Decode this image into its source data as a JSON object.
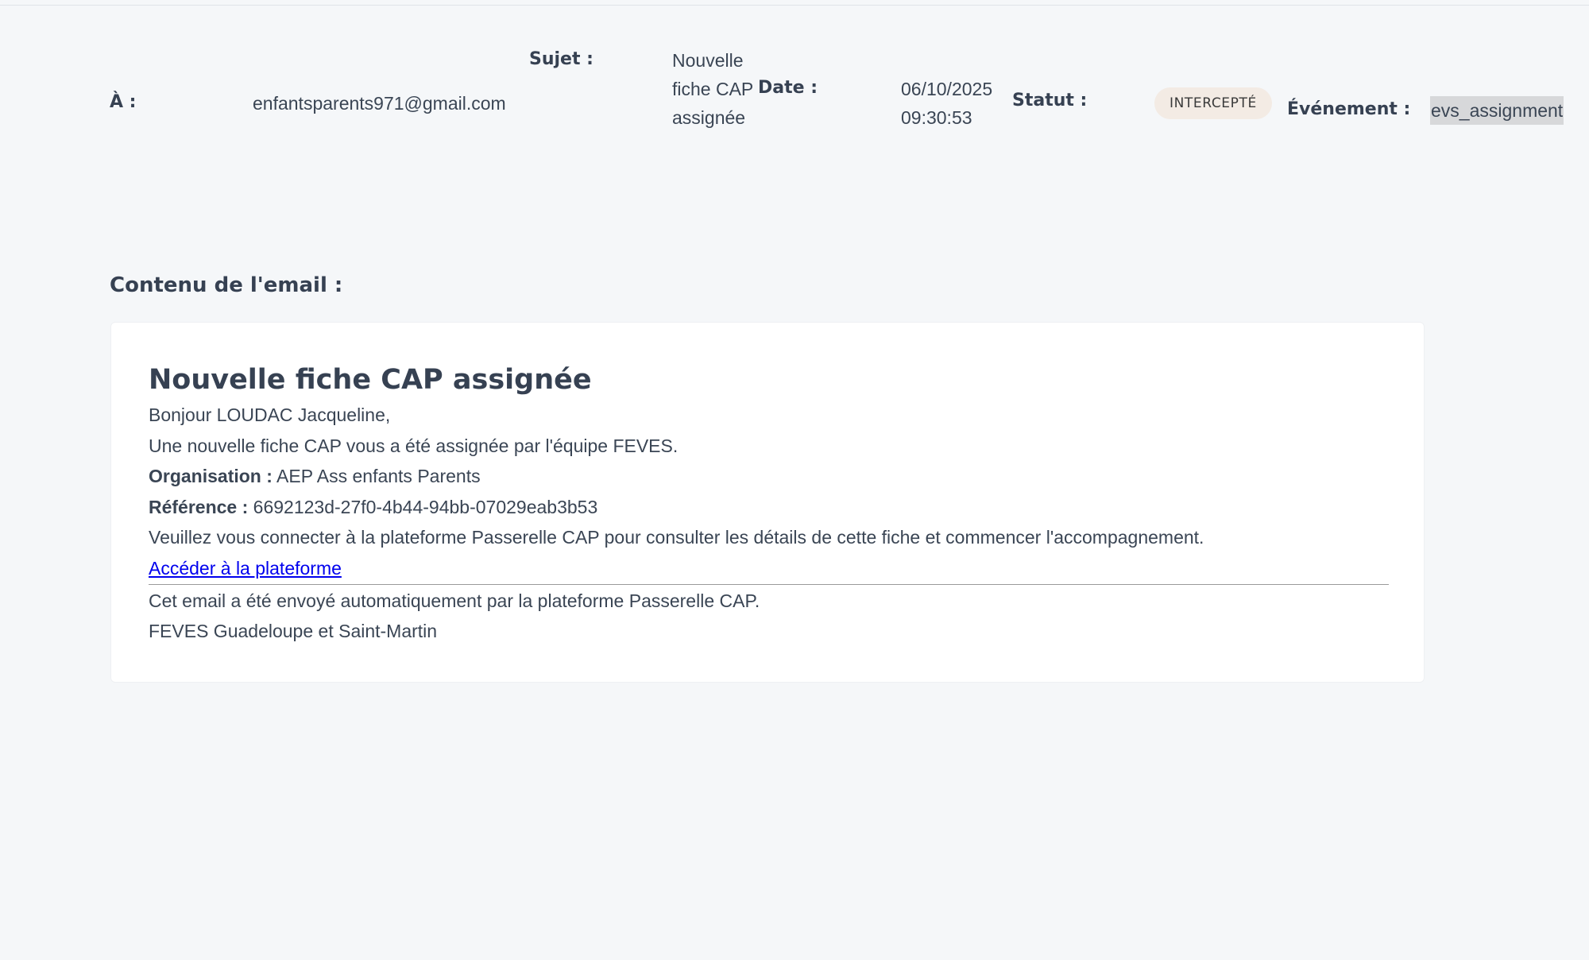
{
  "meta": {
    "to_label": "À :",
    "to_value": "enfantsparents971@gmail.com",
    "subject_label": "Sujet :",
    "subject_value": "Nouvelle fiche CAP assignée",
    "date_label": "Date :",
    "date_value": "06/10/2025 09:30:53",
    "status_label": "Statut :",
    "status_value": "INTERCEPTÉ",
    "event_label": "Événement :",
    "event_value": "evs_assignment"
  },
  "content": {
    "section_title": "Contenu de l'email :",
    "email": {
      "heading": "Nouvelle fiche CAP assignée",
      "greeting": "Bonjour LOUDAC Jacqueline,",
      "intro": "Une nouvelle fiche CAP vous a été assignée par l'équipe FEVES.",
      "organisation_label": "Organisation :",
      "organisation_value": "AEP Ass enfants Parents",
      "reference_label": "Référence :",
      "reference_value": "6692123d-27f0-4b44-94bb-07029eab3b53",
      "instructions": "Veuillez vous connecter à la plateforme Passerelle CAP pour consulter les détails de cette fiche et commencer l'accompagnement.",
      "link_text": "Accéder à la plateforme",
      "footer_auto": "Cet email a été envoyé automatiquement par la plateforme Passerelle CAP.",
      "footer_signature": "FEVES Guadeloupe et Saint-Martin"
    }
  },
  "colors": {
    "page_background": "#f5f7f9",
    "text": "#364152",
    "badge_background": "#f3ebe4",
    "link": "#0000ee"
  }
}
